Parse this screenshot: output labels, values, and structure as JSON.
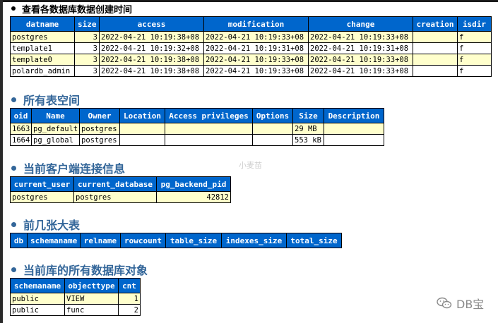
{
  "sections": [
    {
      "title": "查看各数据库数据创建时间",
      "columns": [
        "datname",
        "size",
        "access",
        "modification",
        "change",
        "creation",
        "isdir"
      ],
      "rows": [
        [
          "postgres",
          "3",
          "2022-04-21 10:19:38+08",
          "2022-04-21 10:19:33+08",
          "2022-04-21 10:19:33+08",
          "",
          "f"
        ],
        [
          "template1",
          "3",
          "2022-04-21 10:19:32+08",
          "2022-04-21 10:19:31+08",
          "2022-04-21 10:19:31+08",
          "",
          "f"
        ],
        [
          "template0",
          "3",
          "2022-04-21 10:19:38+08",
          "2022-04-21 10:19:33+08",
          "2022-04-21 10:19:33+08",
          "",
          "f"
        ],
        [
          "polardb_admin",
          "3",
          "2022-04-21 10:19:38+08",
          "2022-04-21 10:19:33+08",
          "2022-04-21 10:19:33+08",
          "",
          "f"
        ]
      ]
    },
    {
      "title": "所有表空间",
      "columns": [
        "oid",
        "Name",
        "Owner",
        "Location",
        "Access privileges",
        "Options",
        "Size",
        "Description"
      ],
      "rows": [
        [
          "1663",
          "pg_default",
          "postgres",
          "",
          "",
          "",
          "29 MB",
          ""
        ],
        [
          "1664",
          "pg_global",
          "postgres",
          "",
          "",
          "",
          "553 kB",
          ""
        ]
      ]
    },
    {
      "title": "当前客户端连接信息",
      "columns": [
        "current_user",
        "current_database",
        "pg_backend_pid"
      ],
      "rows": [
        [
          "postgres",
          "postgres",
          "42812"
        ]
      ]
    },
    {
      "title": "前几张大表",
      "columns": [
        "db",
        "schemaname",
        "relname",
        "rowcount",
        "table_size",
        "indexes_size",
        "total_size"
      ],
      "rows": []
    },
    {
      "title": "当前库的所有数据库对象",
      "columns": [
        "schemaname",
        "objecttype",
        "cnt"
      ],
      "rows": [
        [
          "public",
          "VIEW",
          "1"
        ],
        [
          "public",
          "func",
          "2"
        ]
      ]
    }
  ],
  "watermarks": {
    "center": "小麦苗",
    "brand": "DB宝"
  }
}
